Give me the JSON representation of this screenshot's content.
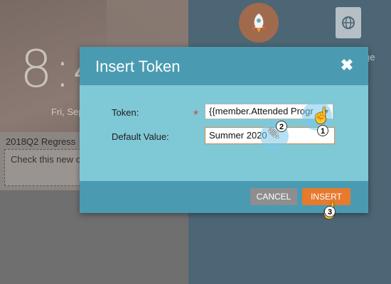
{
  "background": {
    "clock": "8:4",
    "date": "Fri, Sep",
    "card_title": "2018Q2 Regress",
    "card_text": "Check this new of",
    "side_label": "ge"
  },
  "modal": {
    "title": "Insert Token",
    "close_label": "✖",
    "token_label": "Token:",
    "required_mark": "*",
    "token_value": "{{member.Attended Progr",
    "default_label": "Default Value:",
    "default_value": "Summer 2020",
    "cancel_label": "CANCEL",
    "insert_label": "INSERT"
  },
  "steps": {
    "one": "1",
    "two": "2",
    "three": "3"
  },
  "colors": {
    "header": "#4a9bb2",
    "body": "#7fc8d6",
    "insert": "#e67a2d",
    "cancel": "#8e8e8e"
  }
}
